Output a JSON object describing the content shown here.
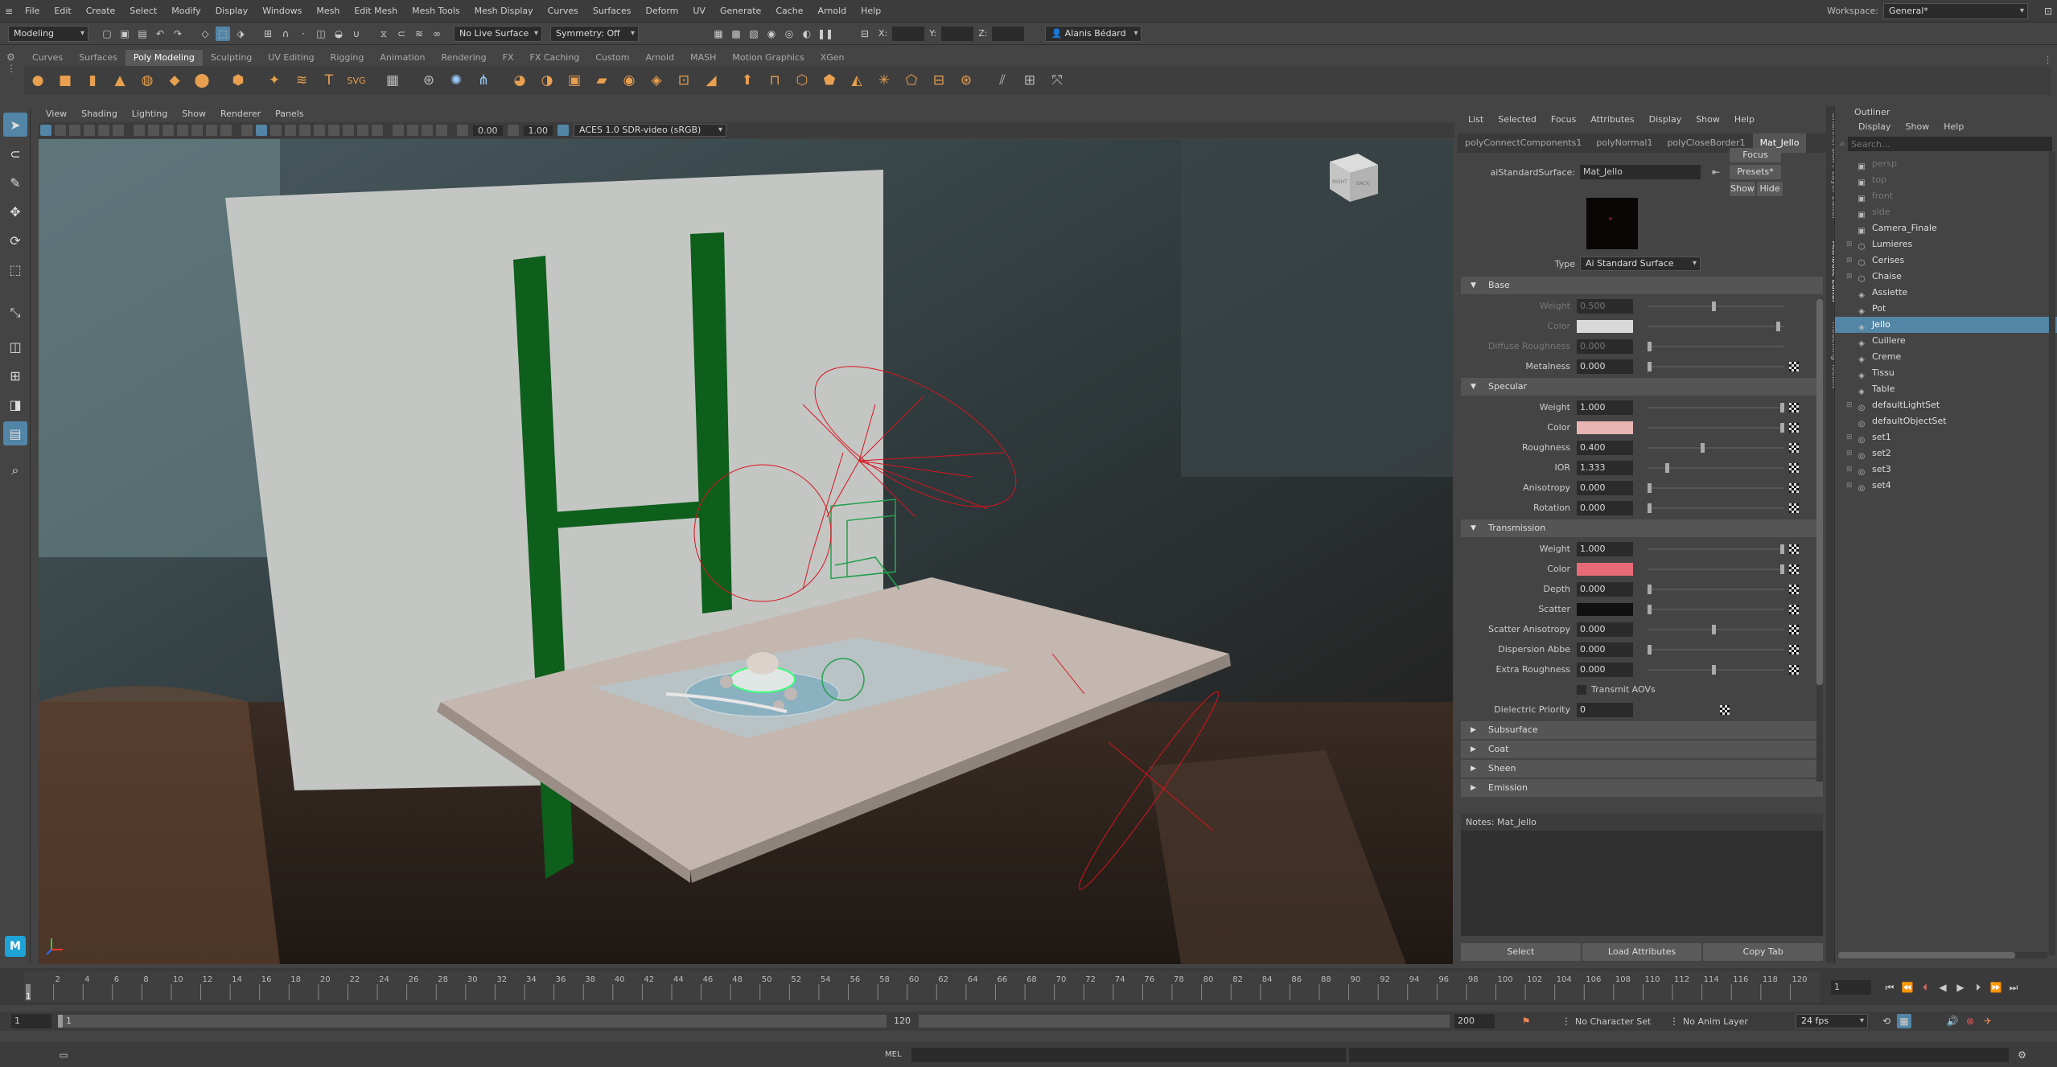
{
  "menubar": {
    "items": [
      "File",
      "Edit",
      "Create",
      "Select",
      "Modify",
      "Display",
      "Windows",
      "Mesh",
      "Edit Mesh",
      "Mesh Tools",
      "Mesh Display",
      "Curves",
      "Surfaces",
      "Deform",
      "UV",
      "Generate",
      "Cache",
      "Arnold",
      "Help"
    ],
    "workspace_label": "Workspace:",
    "workspace_value": "General*"
  },
  "statusline": {
    "mode": "Modeling",
    "live_surface": "No Live Surface",
    "symmetry": "Symmetry: Off",
    "x_label": "X:",
    "y_label": "Y:",
    "z_label": "Z:",
    "user": "Alanis Bédard"
  },
  "shelf": {
    "tabs": [
      "Curves",
      "Surfaces",
      "Poly Modeling",
      "Sculpting",
      "UV Editing",
      "Rigging",
      "Animation",
      "Rendering",
      "FX",
      "FX Caching",
      "Custom",
      "Arnold",
      "MASH",
      "Motion Graphics",
      "XGen"
    ],
    "active_tab": "Poly Modeling"
  },
  "viewport": {
    "menus": [
      "View",
      "Shading",
      "Lighting",
      "Show",
      "Renderer",
      "Panels"
    ],
    "near_value": "0.00",
    "far_value": "1.00",
    "color_space": "ACES 1.0 SDR-video (sRGB)",
    "viewcube_right": "RIGHT",
    "viewcube_back": "BACK"
  },
  "attribute_editor": {
    "menus": [
      "List",
      "Selected",
      "Focus",
      "Attributes",
      "Display",
      "Show",
      "Help"
    ],
    "tabs": [
      "polyConnectComponents1",
      "polyNormal1",
      "polyCloseBorder1",
      "Mat_Jello"
    ],
    "active_tab": "Mat_Jello",
    "node_type_label": "aiStandardSurface:",
    "node_name": "Mat_Jello",
    "focus_btn": "Focus",
    "presets_btn": "Presets*",
    "show_btn": "Show",
    "hide_btn": "Hide",
    "type_label": "Type",
    "type_value": "Ai Standard Surface",
    "base": {
      "title": "Base",
      "weight_label": "Weight",
      "weight": "0.500",
      "color_label": "Color",
      "diffuse_label": "Diffuse Roughness",
      "diffuse": "0.000",
      "metalness_label": "Metalness",
      "metalness": "0.000"
    },
    "specular": {
      "title": "Specular",
      "weight_label": "Weight",
      "weight": "1.000",
      "color_label": "Color",
      "roughness_label": "Roughness",
      "roughness": "0.400",
      "ior_label": "IOR",
      "ior": "1.333",
      "anisotropy_label": "Anisotropy",
      "anisotropy": "0.000",
      "rotation_label": "Rotation",
      "rotation": "0.000"
    },
    "transmission": {
      "title": "Transmission",
      "weight_label": "Weight",
      "weight": "1.000",
      "color_label": "Color",
      "depth_label": "Depth",
      "depth": "0.000",
      "scatter_label": "Scatter",
      "scatter_aniso_label": "Scatter Anisotropy",
      "scatter_aniso": "0.000",
      "dispersion_label": "Dispersion Abbe",
      "dispersion": "0.000",
      "extra_rough_label": "Extra Roughness",
      "extra_rough": "0.000",
      "transmit_aovs_label": "Transmit AOVs"
    },
    "dielectric_label": "Dielectric Priority",
    "dielectric": "0",
    "closed_sections": [
      "Subsurface",
      "Coat",
      "Sheen",
      "Emission"
    ],
    "notes_label": "Notes:  Mat_Jello",
    "select_btn": "Select",
    "load_btn": "Load Attributes",
    "copy_btn": "Copy Tab",
    "side_tabs": [
      "Channel Box / Layer Editor",
      "Attribute Editor",
      "Modelling Toolkit"
    ],
    "colors": {
      "base": "#d8d8d8",
      "spec": "#e8b4b4",
      "trans": "#e86b78",
      "scatter": "#111111"
    }
  },
  "outliner": {
    "title": "Outliner",
    "menus": [
      "Display",
      "Show",
      "Help"
    ],
    "search_placeholder": "Search...",
    "items": [
      {
        "label": "persp",
        "dim": true,
        "exp": false,
        "icon": "camera-icon"
      },
      {
        "label": "top",
        "dim": true,
        "exp": false,
        "icon": "camera-icon"
      },
      {
        "label": "front",
        "dim": true,
        "exp": false,
        "icon": "camera-icon"
      },
      {
        "label": "side",
        "dim": true,
        "exp": false,
        "icon": "camera-icon"
      },
      {
        "label": "Camera_Finale",
        "dim": false,
        "exp": false,
        "icon": "camera-icon"
      },
      {
        "label": "Lumieres",
        "dim": false,
        "exp": true,
        "icon": "group-icon"
      },
      {
        "label": "Cerises",
        "dim": false,
        "exp": true,
        "icon": "group-icon"
      },
      {
        "label": "Chaise",
        "dim": false,
        "exp": true,
        "icon": "group-icon"
      },
      {
        "label": "Assiette",
        "dim": false,
        "exp": false,
        "icon": "mesh-icon"
      },
      {
        "label": "Pot",
        "dim": false,
        "exp": false,
        "icon": "mesh-icon"
      },
      {
        "label": "Jello",
        "dim": false,
        "exp": false,
        "icon": "mesh-icon",
        "sel": true
      },
      {
        "label": "Cuillere",
        "dim": false,
        "exp": false,
        "icon": "mesh-icon"
      },
      {
        "label": "Creme",
        "dim": false,
        "exp": false,
        "icon": "mesh-icon"
      },
      {
        "label": "Tissu",
        "dim": false,
        "exp": false,
        "icon": "mesh-icon"
      },
      {
        "label": "Table",
        "dim": false,
        "exp": false,
        "icon": "mesh-icon"
      },
      {
        "label": "defaultLightSet",
        "dim": false,
        "exp": true,
        "icon": "set-icon"
      },
      {
        "label": "defaultObjectSet",
        "dim": false,
        "exp": false,
        "icon": "set-icon"
      },
      {
        "label": "set1",
        "dim": false,
        "exp": true,
        "icon": "set-icon"
      },
      {
        "label": "set2",
        "dim": false,
        "exp": true,
        "icon": "set-icon"
      },
      {
        "label": "set3",
        "dim": false,
        "exp": true,
        "icon": "set-icon"
      },
      {
        "label": "set4",
        "dim": false,
        "exp": true,
        "icon": "set-icon"
      }
    ]
  },
  "timeline": {
    "ticks": [
      "2",
      "4",
      "6",
      "8",
      "10",
      "12",
      "14",
      "16",
      "18",
      "20",
      "22",
      "24",
      "26",
      "28",
      "30",
      "32",
      "34",
      "36",
      "38",
      "40",
      "42",
      "44",
      "46",
      "48",
      "50",
      "52",
      "54",
      "56",
      "58",
      "60",
      "62",
      "64",
      "66",
      "68",
      "70",
      "72",
      "74",
      "76",
      "78",
      "80",
      "82",
      "84",
      "86",
      "88",
      "90",
      "92",
      "94",
      "96",
      "98",
      "100",
      "102",
      "104",
      "106",
      "108",
      "110",
      "112",
      "114",
      "116",
      "118",
      "120"
    ],
    "current_frame": "1",
    "frame_field": "1"
  },
  "range": {
    "start": "1",
    "inner_start": "1",
    "inner_end": "120",
    "end": "200",
    "char_set": "No Character Set",
    "anim_layer": "No Anim Layer",
    "fps": "24 fps"
  },
  "cmd": {
    "label": "MEL"
  }
}
